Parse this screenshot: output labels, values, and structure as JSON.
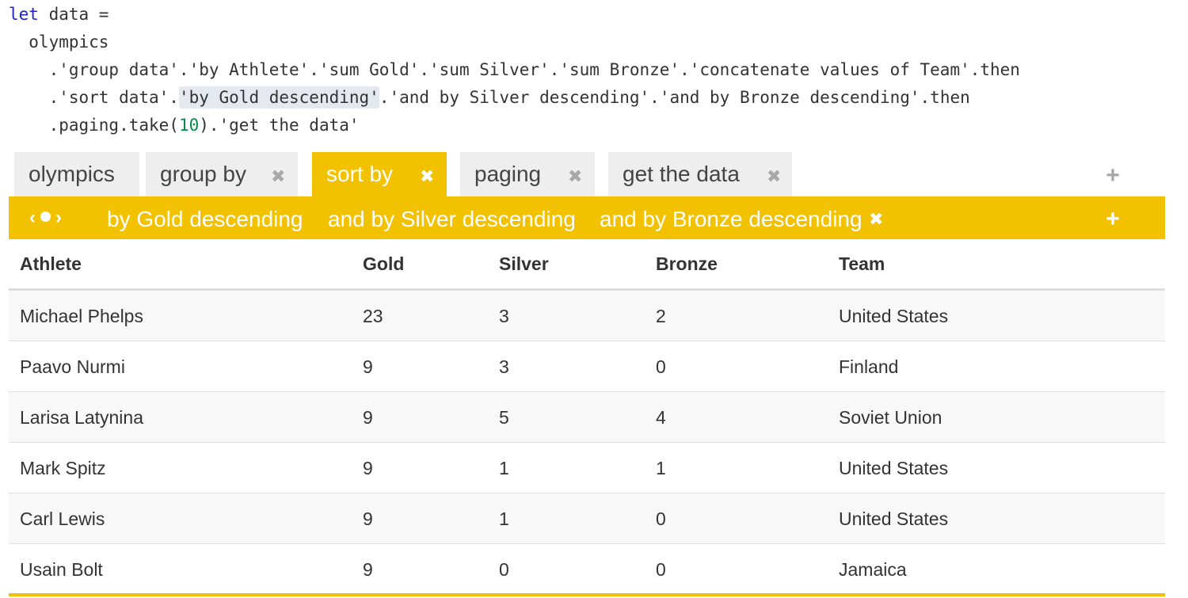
{
  "code": {
    "line1": {
      "keyword": "let",
      "rest": " data ="
    },
    "line2": "  olympics",
    "line3": "    .'group data'.'by Athlete'.'sum Gold'.'sum Silver'.'sum Bronze'.'concatenate values of Team'.then",
    "line4": {
      "prefix": "    .'sort data'.",
      "highlight": "'by Gold descending'",
      "suffix": ".'and by Silver descending'.'and by Bronze descending'.then"
    },
    "line5": {
      "prefix": "    .paging.take(",
      "number": "10",
      "suffix": ").'get the data'"
    }
  },
  "tabs": [
    {
      "label": "olympics",
      "closable": false,
      "active": false
    },
    {
      "label": "group by",
      "closable": true,
      "active": false
    },
    {
      "label": "sort by",
      "closable": true,
      "active": true
    },
    {
      "label": "paging",
      "closable": true,
      "active": false
    },
    {
      "label": "get the data",
      "closable": true,
      "active": false
    }
  ],
  "tab_close_glyph": "✖",
  "add_glyph": "+",
  "sortbar": {
    "prev": "‹",
    "next": "›",
    "items": [
      "by Gold descending",
      "and by Silver descending",
      "and by Bronze descending"
    ]
  },
  "table": {
    "columns": [
      "Athlete",
      "Gold",
      "Silver",
      "Bronze",
      "Team"
    ],
    "rows": [
      [
        "Michael Phelps",
        "23",
        "3",
        "2",
        "United States"
      ],
      [
        "Paavo Nurmi",
        "9",
        "3",
        "0",
        "Finland"
      ],
      [
        "Larisa Latynina",
        "9",
        "5",
        "4",
        "Soviet Union"
      ],
      [
        "Mark Spitz",
        "9",
        "1",
        "1",
        "United States"
      ],
      [
        "Carl Lewis",
        "9",
        "1",
        "0",
        "United States"
      ],
      [
        "Usain Bolt",
        "9",
        "0",
        "0",
        "Jamaica"
      ]
    ]
  },
  "colors": {
    "accent": "#f2c200",
    "keyword": "#2222cc",
    "number": "#0a8a4a",
    "highlight": "#e4e9f0"
  }
}
